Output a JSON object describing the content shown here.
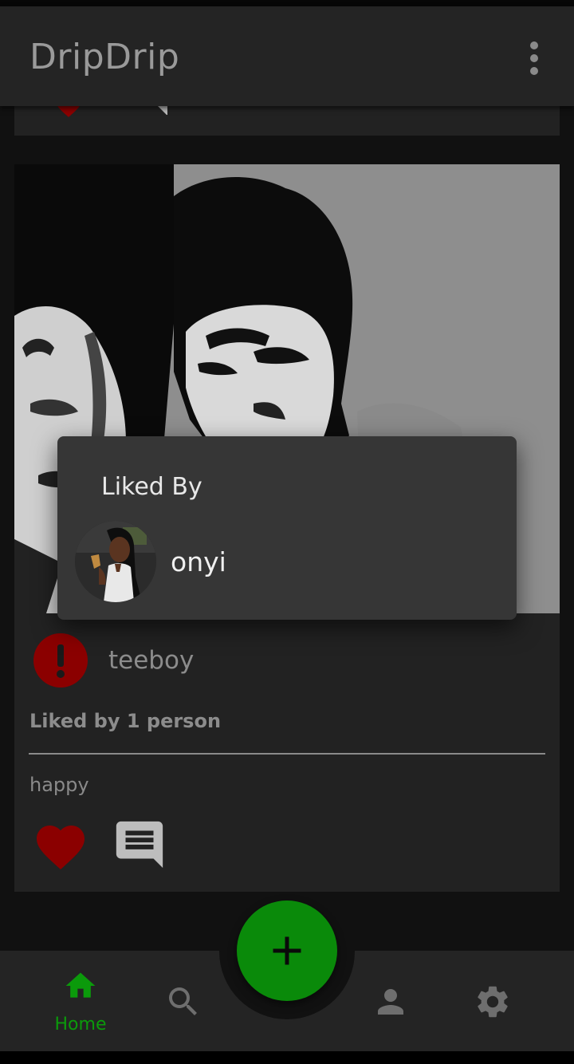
{
  "app": {
    "title": "DripDrip"
  },
  "post": {
    "author": "teeboy",
    "likes_text": "Liked by 1 person",
    "caption": "happy"
  },
  "dialog": {
    "title": "Liked By",
    "likers": [
      {
        "name": "onyi"
      }
    ]
  },
  "nav": {
    "home_label": "Home",
    "active": "home"
  },
  "colors": {
    "accent": "#0a8a0a",
    "like": "#8b0000",
    "app_bar": "#242424",
    "dialog": "#363636"
  },
  "icons": {
    "menu": "more-vert-icon",
    "like": "heart-icon",
    "comment": "comment-icon",
    "author_avatar": "error-icon",
    "fab": "plus-icon",
    "home": "home-icon",
    "search": "search-icon",
    "profile": "person-icon",
    "settings": "gear-icon"
  }
}
